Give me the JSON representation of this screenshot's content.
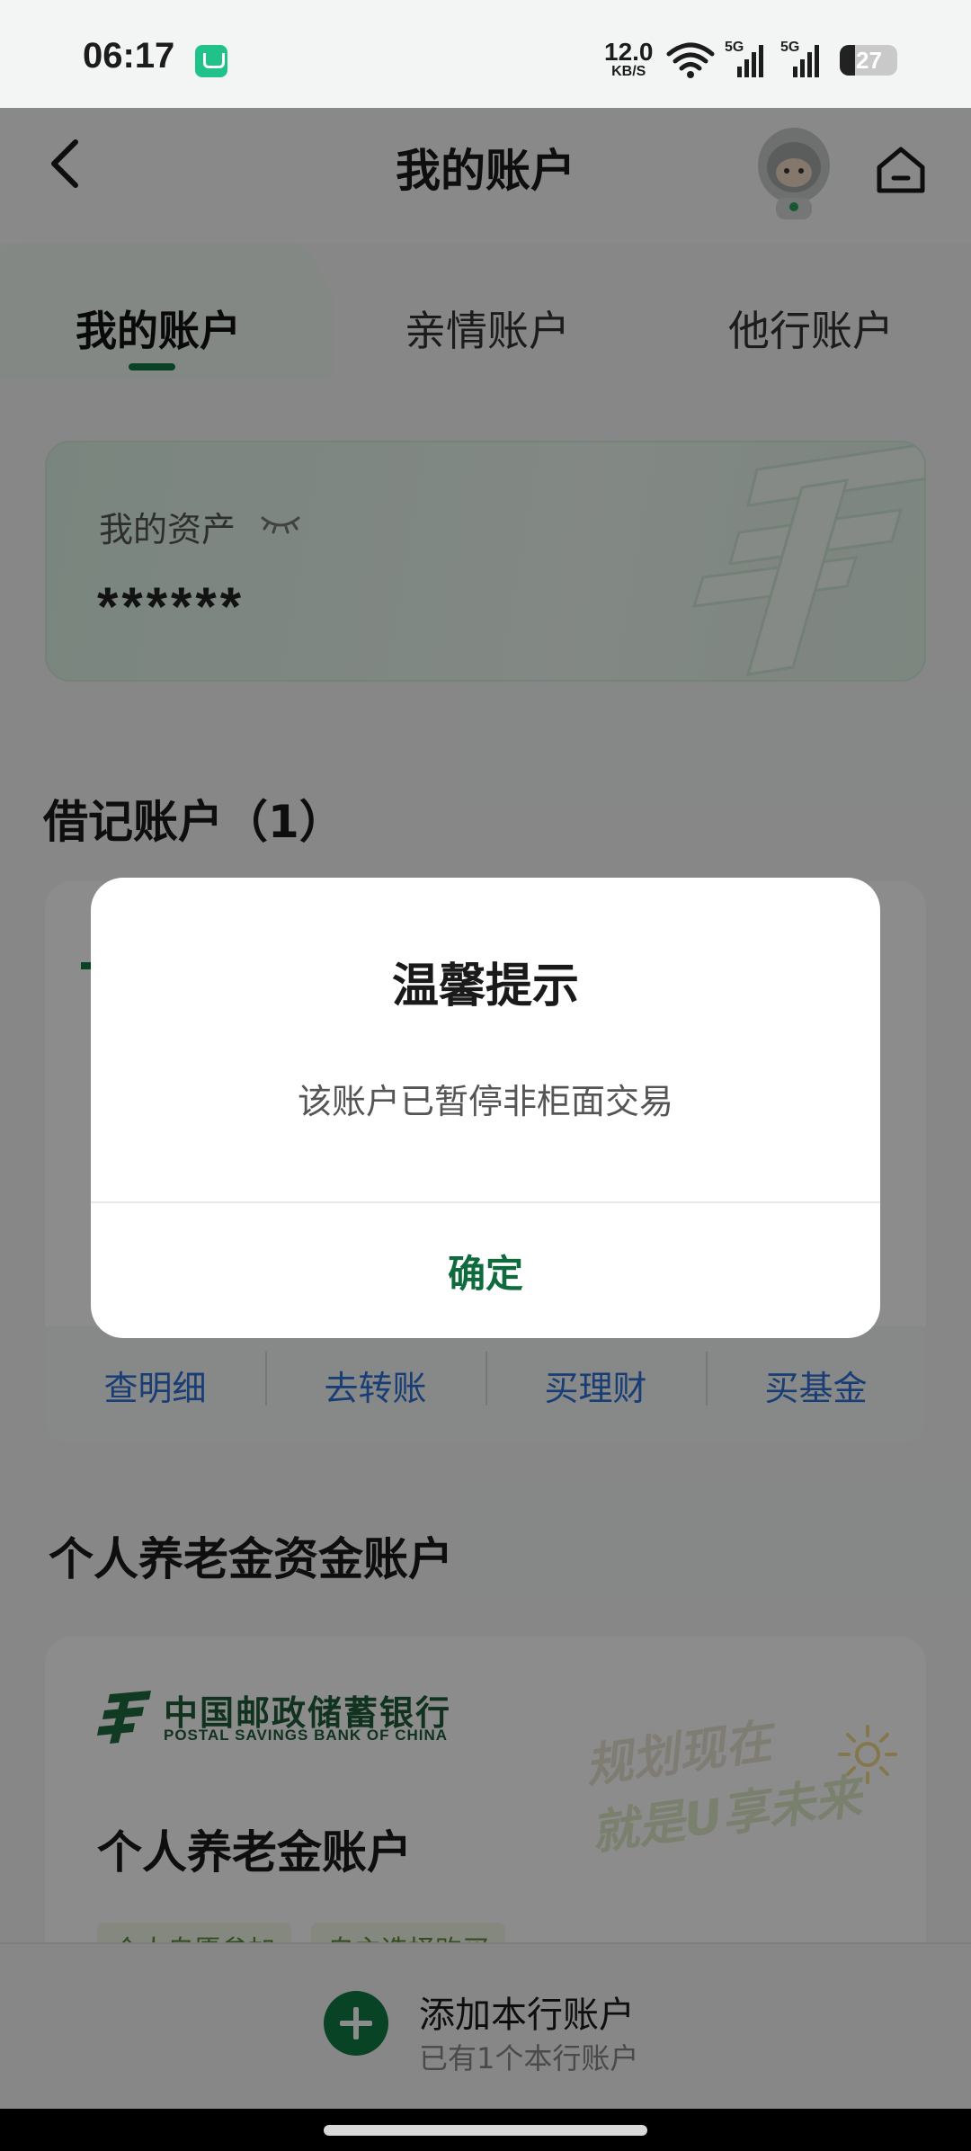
{
  "status_bar": {
    "time": "06:17",
    "net_speed_value": "12.0",
    "net_speed_unit": "KB/S",
    "signal1_label": "5G",
    "signal2_label": "5G",
    "battery": "27",
    "battery_level": 0.27
  },
  "header": {
    "title": "我的账户",
    "icons": [
      "back-arrow-icon",
      "mascot-avatar",
      "home-icon"
    ]
  },
  "tabs": [
    {
      "label": "我的账户",
      "active": true
    },
    {
      "label": "亲情账户",
      "active": false
    },
    {
      "label": "他行账户",
      "active": false
    }
  ],
  "assets": {
    "label": "我的资产",
    "value": "******"
  },
  "debit": {
    "section_title": "借记账户（1）",
    "actions": [
      "查明细",
      "去转账",
      "买理财",
      "买基金"
    ]
  },
  "pension": {
    "section_title": "个人养老金资金账户",
    "bank_name_cn": "中国邮政储蓄银行",
    "bank_name_en": "POSTAL SAVINGS BANK OF CHINA",
    "slogan_line1": "规划现在",
    "slogan_line2": "就是U享未来",
    "account_title": "个人养老金账户",
    "tags": [
      "个人自愿参加",
      "自主选择购买"
    ]
  },
  "bottom": {
    "add_title": "添加本行账户",
    "add_subtitle": "已有1个本行账户"
  },
  "dialog": {
    "title": "温馨提示",
    "message": "该账户已暂停非柜面交易",
    "confirm_label": "确定"
  },
  "colors": {
    "brand_green": "#0f7a46",
    "action_blue": "#2f6fd6",
    "overlay": "rgba(0,0,0,0.45)"
  }
}
